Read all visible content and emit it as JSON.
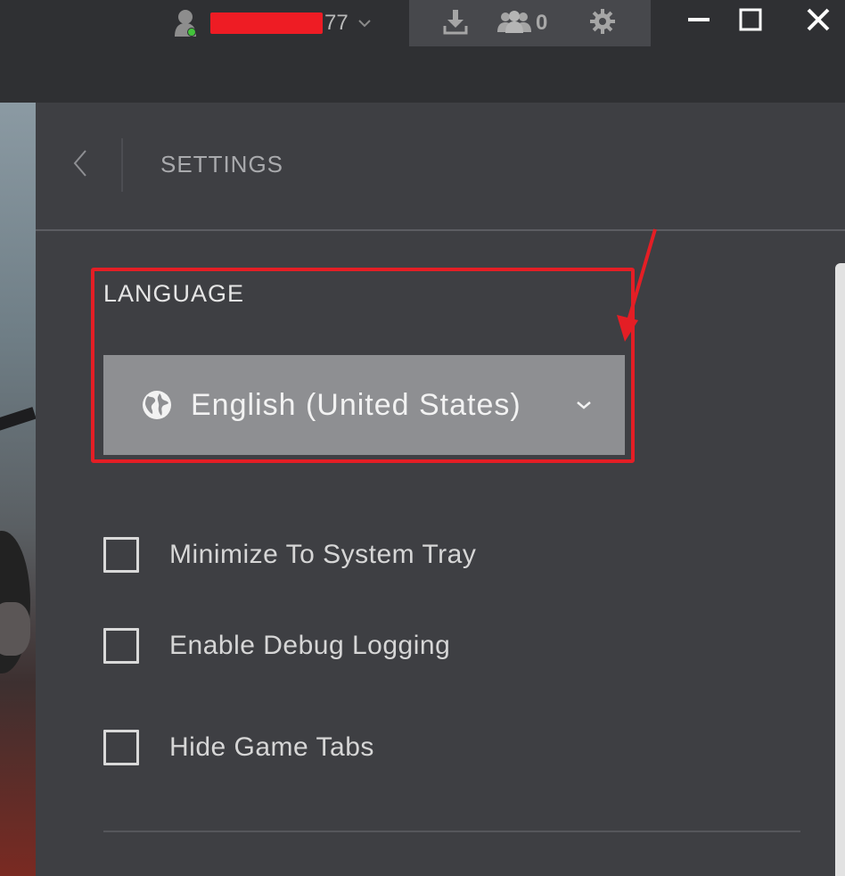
{
  "header": {
    "username_suffix": "77",
    "friends_online_count": "0"
  },
  "settings": {
    "title": "SETTINGS",
    "language": {
      "section_label": "LANGUAGE",
      "selected": "English (United States)"
    },
    "options": [
      {
        "label": "Minimize To System Tray",
        "checked": false
      },
      {
        "label": "Enable Debug Logging",
        "checked": false
      },
      {
        "label": "Hide Game Tabs",
        "checked": false
      }
    ]
  },
  "colors": {
    "annotation_red": "#e41e25",
    "online_status": "#43c33b",
    "panel_bg": "#3e3f43",
    "dropdown_bg": "#8e8f92"
  },
  "icons": {
    "user": "user-icon",
    "download": "download-icon",
    "friends": "friends-icon",
    "settings": "gear-icon",
    "language": "globe-icon"
  }
}
